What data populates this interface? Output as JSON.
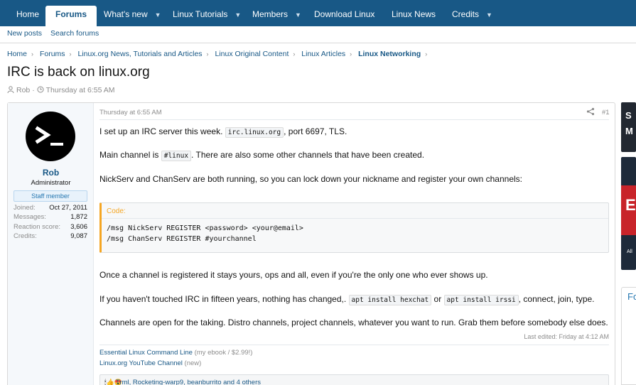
{
  "nav": {
    "tabs": [
      {
        "label": "Home"
      },
      {
        "label": "Forums"
      },
      {
        "label": "What's new"
      },
      {
        "label": "Linux Tutorials"
      },
      {
        "label": "Members"
      },
      {
        "label": "Download Linux"
      },
      {
        "label": "Linux News"
      },
      {
        "label": "Credits"
      }
    ],
    "sub": [
      "New posts",
      "Search forums"
    ]
  },
  "breadcrumb": [
    "Home",
    "Forums",
    "Linux.org News, Tutorials and Articles",
    "Linux Original Content",
    "Linux Articles",
    "Linux Networking"
  ],
  "thread": {
    "title": "IRC is back on linux.org",
    "author": "Rob",
    "date": "Thursday at 6:55 AM"
  },
  "user": {
    "name": "Rob",
    "title": "Administrator",
    "badge": "Staff member",
    "avatar_glyph": ">_",
    "stats": [
      {
        "k": "Joined:",
        "v": "Oct 27, 2011"
      },
      {
        "k": "Messages:",
        "v": "1,872"
      },
      {
        "k": "Reaction score:",
        "v": "3,606"
      },
      {
        "k": "Credits:",
        "v": "9,087"
      }
    ]
  },
  "post": {
    "time": "Thursday at 6:55 AM",
    "number": "#1",
    "p1": {
      "a": "I set up an IRC server this week. ",
      "code": "irc.linux.org",
      "b": ", port 6697, TLS."
    },
    "p2": {
      "a": "Main channel is ",
      "code": "#linux",
      "b": ". There are also some other channels that have been created."
    },
    "p3": "NickServ and ChanServ are both running, so you can lock down your nickname and register your own channels:",
    "code_label": "Code:",
    "code_lines": [
      "/msg NickServ REGISTER <password> <your@email>",
      "/msg ChanServ REGISTER #yourchannel"
    ],
    "p4": "Once a channel is registered it stays yours, ops and all, even if you're the only one who ever shows up.",
    "p5": {
      "a": "If you haven't touched IRC in fifteen years, nothing has changed,. ",
      "code1": "apt install hexchat",
      "or": " or ",
      "code2": "apt install irssi",
      "b": ", connect, join, type."
    },
    "p6": "Channels are open for the taking. Distro channels, project channels, whatever you want to run. Grab them before somebody else does.",
    "edited": "Last edited: Friday at 4:12 AM",
    "sig1": {
      "link": "Essential Linux Command Line",
      "note": " (my ebook / $2.99!)"
    },
    "sig2": {
      "link": "Linux.org YouTube Channel",
      "note": " (new)"
    },
    "reactions_emoji": "🕯👍😍",
    "reactions_text": "Trml, Rocketing-warp9, beanburrito and 4 others"
  },
  "sidebar": {
    "ad1_text": "S\nM",
    "ad2_text": "E",
    "ad2_small": "All",
    "block_title": "Fo"
  }
}
